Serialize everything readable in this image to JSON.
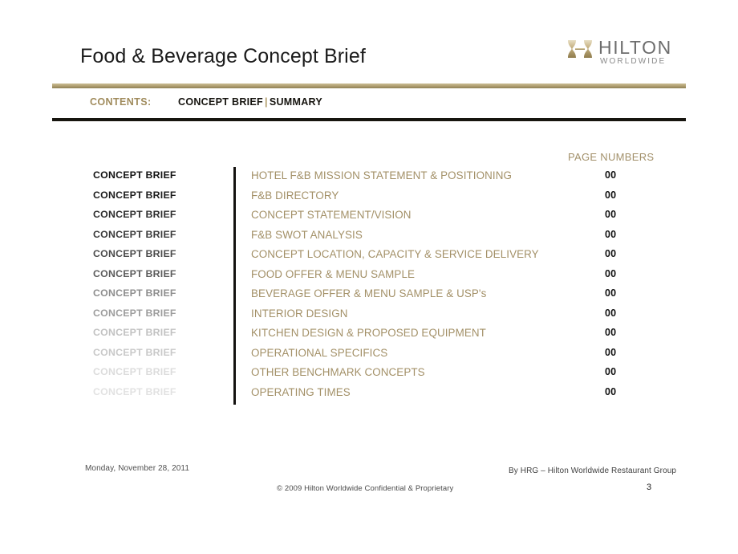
{
  "header": {
    "title": "Food & Beverage Concept Brief",
    "logo": {
      "mark": "hilton-h-mark",
      "wordmark": "HILTON",
      "sub_wordmark": "WORLDWIDE"
    }
  },
  "contents_bar": {
    "label": "CONTENTS:",
    "value_primary": "CONCEPT BRIEF",
    "separator": "|",
    "value_secondary": "SUMMARY"
  },
  "table": {
    "page_numbers_header": "PAGE NUMBERS",
    "rows": [
      {
        "tag": "CONCEPT BRIEF",
        "item": "HOTEL F&B MISSION STATEMENT & POSITIONING",
        "page": "00",
        "tag_color": "#131313"
      },
      {
        "tag": "CONCEPT BRIEF",
        "item": "F&B DIRECTORY",
        "page": "00",
        "tag_color": "#1d1d1d"
      },
      {
        "tag": "CONCEPT BRIEF",
        "item": "CONCEPT STATEMENT/VISION",
        "page": "00",
        "tag_color": "#2e2e2e"
      },
      {
        "tag": "CONCEPT BRIEF",
        "item": "F&B SWOT ANALYSIS",
        "page": "00",
        "tag_color": "#3b3b3b"
      },
      {
        "tag": "CONCEPT BRIEF",
        "item": "CONCEPT LOCATION, CAPACITY & SERVICE DELIVERY",
        "page": "00",
        "tag_color": "#4b4b4b"
      },
      {
        "tag": "CONCEPT BRIEF",
        "item": "FOOD OFFER & MENU SAMPLE",
        "page": "00",
        "tag_color": "#5c5c5c"
      },
      {
        "tag": "CONCEPT BRIEF",
        "item": "BEVERAGE OFFER & MENU SAMPLE & USP's",
        "page": "00",
        "tag_color": "#8e8e8e"
      },
      {
        "tag": "CONCEPT BRIEF",
        "item": "INTERIOR DESIGN",
        "page": "00",
        "tag_color": "#9d9d9d"
      },
      {
        "tag": "CONCEPT BRIEF",
        "item": "KITCHEN DESIGN & PROPOSED EQUIPMENT",
        "page": "00",
        "tag_color": "#c2c2c2"
      },
      {
        "tag": "CONCEPT BRIEF",
        "item": "OPERATIONAL SPECIFICS",
        "page": "00",
        "tag_color": "#c9c9c9"
      },
      {
        "tag": "CONCEPT BRIEF",
        "item": "OTHER BENCHMARK CONCEPTS",
        "page": "00",
        "tag_color": "#dcdcdc"
      },
      {
        "tag": "CONCEPT BRIEF",
        "item": "OPERATING TIMES",
        "page": "00",
        "tag_color": "#e2e2e2"
      }
    ]
  },
  "footer": {
    "date": "Monday, November 28, 2011",
    "credit": "By HRG – Hilton Worldwide Restaurant Group",
    "copyright": "© 2009  Hilton Worldwide Confidential & Proprietary",
    "page_number": "3"
  },
  "colors": {
    "gold": "#a39067",
    "gold_rule": "#b5a477",
    "dark_rule": "#17150f",
    "background": "#ffffff"
  }
}
